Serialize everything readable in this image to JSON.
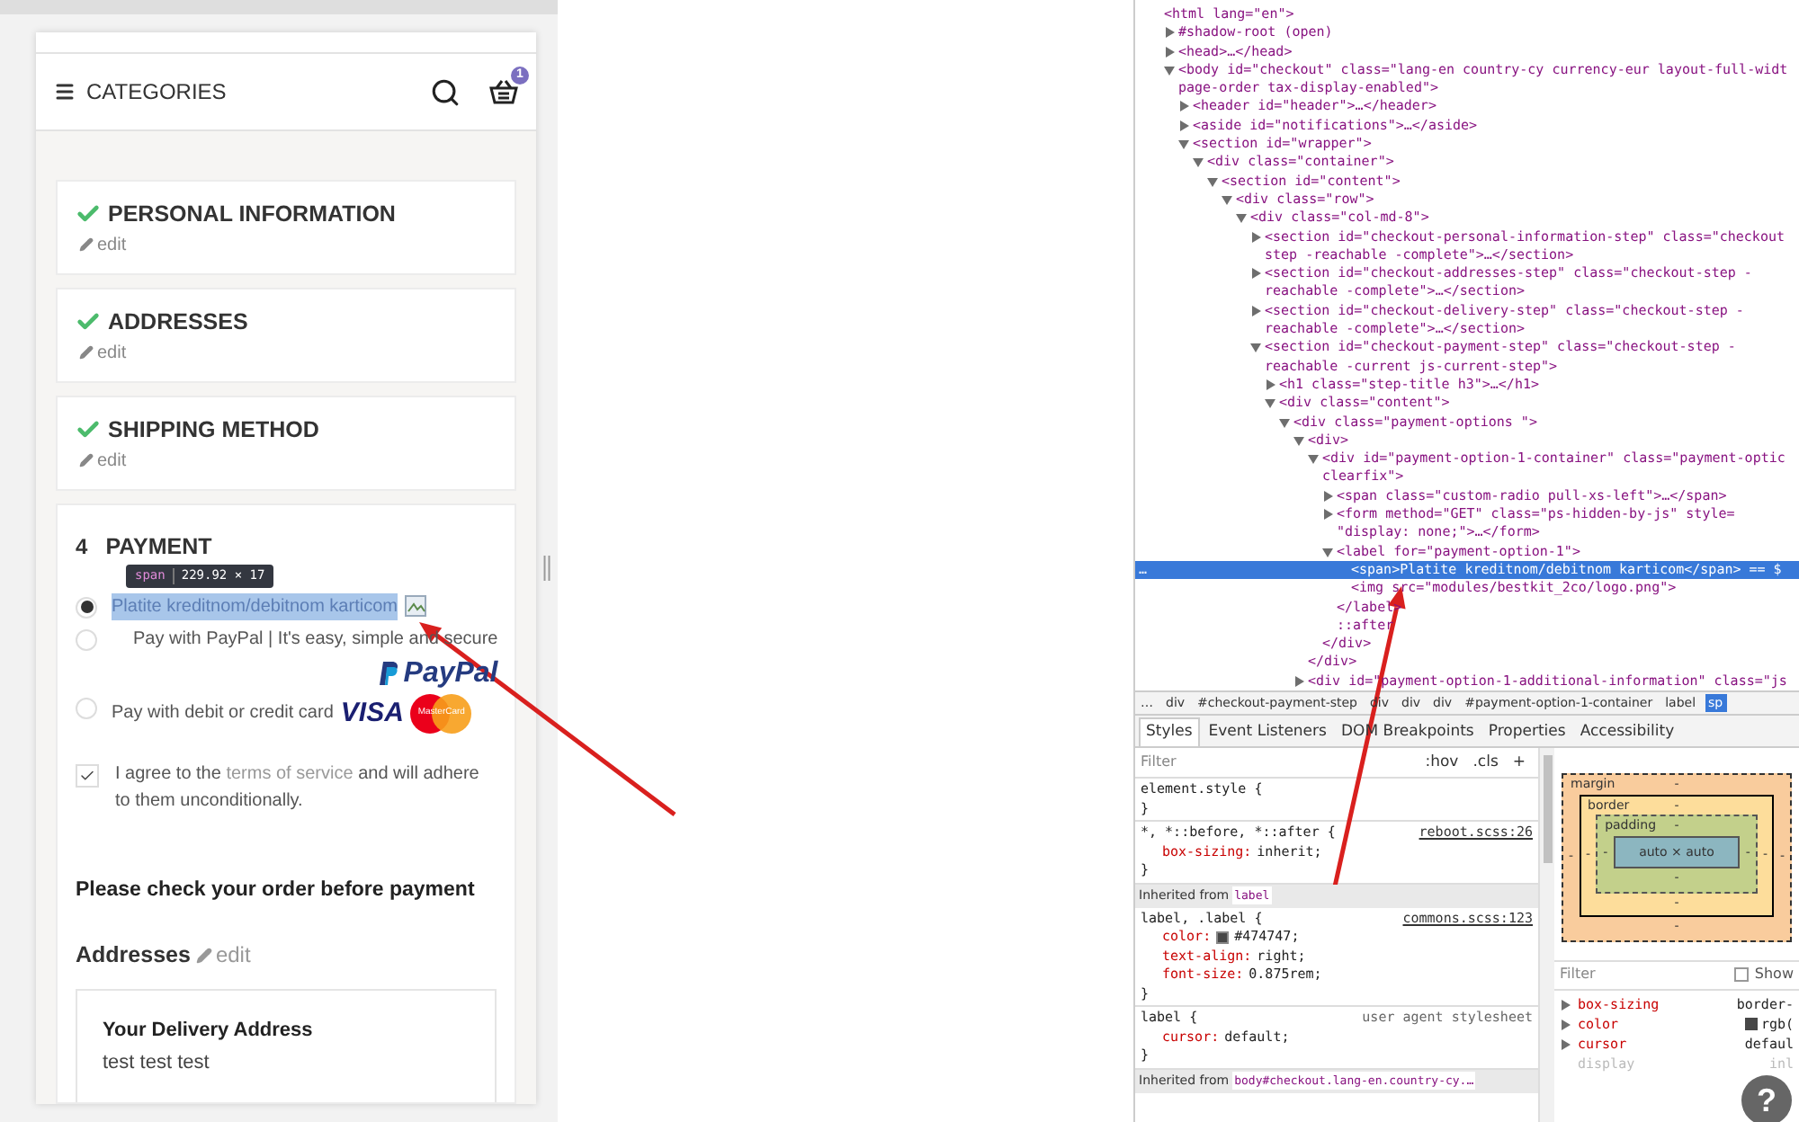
{
  "page": {
    "header": {
      "menu_label": "CATEGORIES",
      "cart_count": "1"
    },
    "steps": [
      {
        "title": "PERSONAL INFORMATION",
        "complete": true,
        "edit": "edit"
      },
      {
        "title": "ADDRESSES",
        "complete": true,
        "edit": "edit"
      },
      {
        "title": "SHIPPING METHOD",
        "complete": true,
        "edit": "edit"
      },
      {
        "number": "4",
        "title": "PAYMENT",
        "complete": false
      }
    ],
    "payment_options": [
      {
        "label": "Platite kreditnom/debitnom karticom",
        "selected": true,
        "highlighted": true,
        "logos": [
          {
            "kind": "broken-image"
          }
        ]
      },
      {
        "label": "Pay with PayPal | It's easy, simple and secure",
        "selected": false,
        "highlighted": false,
        "logos": [
          {
            "kind": "paypal",
            "text": "PayPal"
          }
        ]
      },
      {
        "label": "Pay with debit or credit card",
        "selected": false,
        "highlighted": false,
        "logos": [
          {
            "kind": "visa",
            "text": "VISA"
          },
          {
            "kind": "mastercard",
            "text": "MasterCard"
          }
        ]
      }
    ],
    "terms": {
      "checked": true,
      "before": "I agree to the",
      "link": "terms of service",
      "after": "and will adhere to them unconditionally."
    },
    "review_title": "Please check your order before payment",
    "addresses": {
      "title": "Addresses",
      "edit": "edit",
      "card_title": "Your Delivery Address",
      "lines": [
        "test test test"
      ]
    }
  },
  "inspect_tooltip": {
    "tag": "span",
    "size": "229.92 × 17"
  },
  "annotations": [
    {
      "kind": "arrow"
    },
    {
      "kind": "arrow"
    }
  ],
  "devtools": {
    "dom_tree": [
      {
        "lines": [
          "<html lang=\"en\">"
        ],
        "children": [
          {
            "lines": [
              "#shadow-root (open)"
            ],
            "expanded": false
          },
          {
            "lines": [
              "<head>…</head>"
            ],
            "expanded": false
          },
          {
            "lines": [
              "<body id=\"checkout\" class=\"lang-en country-cy currency-eur layout-full-widt",
              "page-order tax-display-enabled\">"
            ],
            "expanded": true,
            "children": [
              {
                "lines": [
                  "<header id=\"header\">…</header>"
                ],
                "expanded": false
              },
              {
                "lines": [
                  "<aside id=\"notifications\">…</aside>"
                ],
                "expanded": false
              },
              {
                "lines": [
                  "<section id=\"wrapper\">"
                ],
                "expanded": true,
                "children": [
                  {
                    "lines": [
                      "<div class=\"container\">"
                    ],
                    "expanded": true,
                    "children": [
                      {
                        "lines": [
                          "<section id=\"content\">"
                        ],
                        "expanded": true,
                        "children": [
                          {
                            "lines": [
                              "<div class=\"row\">"
                            ],
                            "expanded": true,
                            "children": [
                              {
                                "lines": [
                                  "<div class=\"col-md-8\">"
                                ],
                                "expanded": true,
                                "children": [
                                  {
                                    "lines": [
                                      "<section id=\"checkout-personal-information-step\" class=\"checkout",
                                      "step -reachable -complete\">…</section>"
                                    ],
                                    "expanded": false
                                  },
                                  {
                                    "lines": [
                                      "<section id=\"checkout-addresses-step\" class=\"checkout-step -",
                                      "reachable -complete\">…</section>"
                                    ],
                                    "expanded": false
                                  },
                                  {
                                    "lines": [
                                      "<section id=\"checkout-delivery-step\" class=\"checkout-step -",
                                      "reachable -complete\">…</section>"
                                    ],
                                    "expanded": false
                                  },
                                  {
                                    "lines": [
                                      "<section id=\"checkout-payment-step\" class=\"checkout-step -",
                                      "reachable -current js-current-step\">"
                                    ],
                                    "expanded": true,
                                    "children": [
                                      {
                                        "lines": [
                                          "<h1 class=\"step-title h3\">…</h1>"
                                        ],
                                        "expanded": false
                                      },
                                      {
                                        "lines": [
                                          "<div class=\"content\">"
                                        ],
                                        "expanded": true,
                                        "children": [
                                          {
                                            "lines": [
                                              "<div class=\"payment-options \">"
                                            ],
                                            "expanded": true,
                                            "children": [
                                              {
                                                "lines": [
                                                  "<div>"
                                                ],
                                                "expanded": true,
                                                "closing": "</div>",
                                                "children": [
                                                  {
                                                    "lines": [
                                                      "<div id=\"payment-option-1-container\" class=\"payment-optic",
                                                      "clearfix\">"
                                                    ],
                                                    "expanded": true,
                                                    "closing": "</div>",
                                                    "children": [
                                                      {
                                                        "lines": [
                                                          "<span class=\"custom-radio pull-xs-left\">…</span>"
                                                        ],
                                                        "expanded": false
                                                      },
                                                      {
                                                        "lines": [
                                                          "<form method=\"GET\" class=\"ps-hidden-by-js\" style=",
                                                          "\"display: none;\">…</form>"
                                                        ],
                                                        "expanded": false
                                                      },
                                                      {
                                                        "lines": [
                                                          "<label for=\"payment-option-1\">"
                                                        ],
                                                        "expanded": true,
                                                        "closing": "</label>",
                                                        "children": [
                                                          {
                                                            "lines": [
                                                              "<span>Platite kreditnom/debitnom karticom</span> == $"
                                                            ],
                                                            "selected": true,
                                                            "marker": "…"
                                                          },
                                                          {
                                                            "lines": [
                                                              "<img src=\"modules/bestkit_2co/logo.png\">"
                                                            ],
                                                            "selected": false
                                                          }
                                                        ]
                                                      },
                                                      {
                                                        "lines": [
                                                          "::after"
                                                        ],
                                                        "selected": false
                                                      }
                                                    ]
                                                  }
                                                ]
                                              },
                                              {
                                                "lines": [
                                                  "<div id=\"payment-option-1-additional-information\" class=\"js"
                                                ],
                                                "expanded": false
                                              }
                                            ]
                                          }
                                        ]
                                      }
                                    ]
                                  }
                                ]
                              }
                            ]
                          }
                        ]
                      }
                    ]
                  }
                ]
              }
            ]
          }
        ]
      }
    ],
    "breadcrumbs": [
      {
        "label": "…",
        "selected": false
      },
      {
        "label": "div",
        "selected": false
      },
      {
        "label": "#checkout-payment-step",
        "selected": false
      },
      {
        "label": "div",
        "selected": false
      },
      {
        "label": "div",
        "selected": false
      },
      {
        "label": "div",
        "selected": false
      },
      {
        "label": "#payment-option-1-container",
        "selected": false
      },
      {
        "label": "label",
        "selected": false
      },
      {
        "label": "sp",
        "selected": true
      }
    ],
    "tabs": [
      {
        "label": "Styles",
        "selected": true
      },
      {
        "label": "Event Listeners",
        "selected": false
      },
      {
        "label": "DOM Breakpoints",
        "selected": false
      },
      {
        "label": "Properties",
        "selected": false
      },
      {
        "label": "Accessibility",
        "selected": false
      }
    ],
    "styles": {
      "filter_placeholder": "Filter",
      "buttons": [
        ":hov",
        ".cls",
        "+"
      ],
      "rules": [
        {
          "kind": "rule",
          "selector": "element.style {",
          "close": "}"
        },
        {
          "kind": "rule",
          "selector": "*, *::before, *::after {",
          "source": "reboot.scss:26",
          "source_link": true,
          "close": "}",
          "declarations": [
            {
              "prop": "box-sizing:",
              "value": "inherit;"
            }
          ]
        },
        {
          "kind": "inherited",
          "label": "Inherited from",
          "from": "label"
        },
        {
          "kind": "rule",
          "selector": "label, .label {",
          "source": "commons.scss:123",
          "source_link": true,
          "close": "}",
          "declarations": [
            {
              "prop": "color:",
              "value": "#474747;",
              "color": "#474747"
            },
            {
              "prop": "text-align:",
              "value": "right;"
            },
            {
              "prop": "font-size:",
              "value": "0.875rem;"
            }
          ]
        },
        {
          "kind": "rule",
          "selector": "label {",
          "source": "user agent stylesheet",
          "source_link": false,
          "close": "}",
          "declarations": [
            {
              "prop": "cursor:",
              "value": "default;"
            }
          ]
        },
        {
          "kind": "inherited",
          "label": "Inherited from",
          "from": "body#checkout.lang-en.country-cy.…"
        }
      ]
    },
    "box_model": {
      "margin": {
        "label": "margin",
        "top": "-",
        "right": "-",
        "bottom": "-",
        "left": "-"
      },
      "border": {
        "label": "border",
        "top": "-",
        "right": "-",
        "bottom": "-",
        "left": "-"
      },
      "padding": {
        "label": "padding",
        "top": "-",
        "right": "-",
        "bottom": "-",
        "left": "-"
      },
      "content": "auto × auto"
    },
    "computed": {
      "filter_placeholder": "Filter",
      "show_all": {
        "label": "Show",
        "checked": false
      },
      "props": [
        {
          "name": "box-sizing",
          "value": "border-",
          "inactive": false
        },
        {
          "name": "color",
          "value": "rgb(",
          "color": "#474747",
          "inactive": false
        },
        {
          "name": "cursor",
          "value": "defaul",
          "inactive": false
        },
        {
          "name": "display",
          "value": "inl",
          "inactive": true
        }
      ]
    },
    "help": "?"
  }
}
